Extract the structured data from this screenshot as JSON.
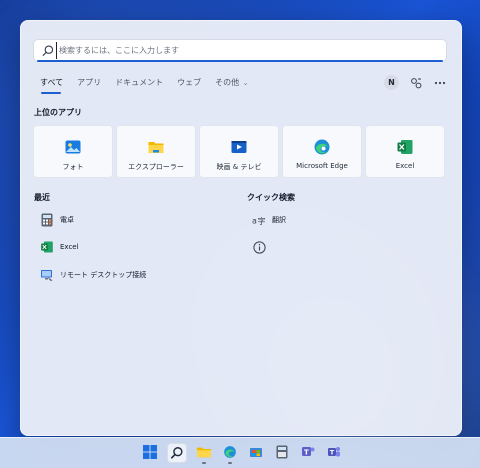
{
  "search": {
    "placeholder": "検索するには、ここに入力します"
  },
  "tabs": {
    "all": "すべて",
    "apps": "アプリ",
    "documents": "ドキュメント",
    "web": "ウェブ",
    "more": "その他"
  },
  "header_right": {
    "avatar_letter": "N"
  },
  "top_apps": {
    "title": "上位のアプリ",
    "items": [
      {
        "label": "フォト",
        "icon": "photos-icon"
      },
      {
        "label": "エクスプローラー",
        "icon": "file-explorer-icon"
      },
      {
        "label": "映画 & テレビ",
        "icon": "movies-tv-icon"
      },
      {
        "label": "Microsoft Edge",
        "icon": "edge-icon"
      },
      {
        "label": "Excel",
        "icon": "excel-icon"
      }
    ]
  },
  "recent": {
    "title": "最近",
    "items": [
      {
        "label": "電卓",
        "icon": "calculator-icon"
      },
      {
        "label": "Excel",
        "icon": "excel-icon"
      },
      {
        "label": "リモート デスクトップ接続",
        "icon": "remote-desktop-icon"
      }
    ]
  },
  "quick_search": {
    "title": "クイック検索",
    "items": [
      {
        "label": "翻訳",
        "icon": "translate-icon"
      },
      {
        "label": "",
        "icon": "info-icon"
      }
    ]
  },
  "colors": {
    "accent": "#1b5fd0",
    "panel_bg": "#ebeef8",
    "excel_green": "#107c41"
  }
}
